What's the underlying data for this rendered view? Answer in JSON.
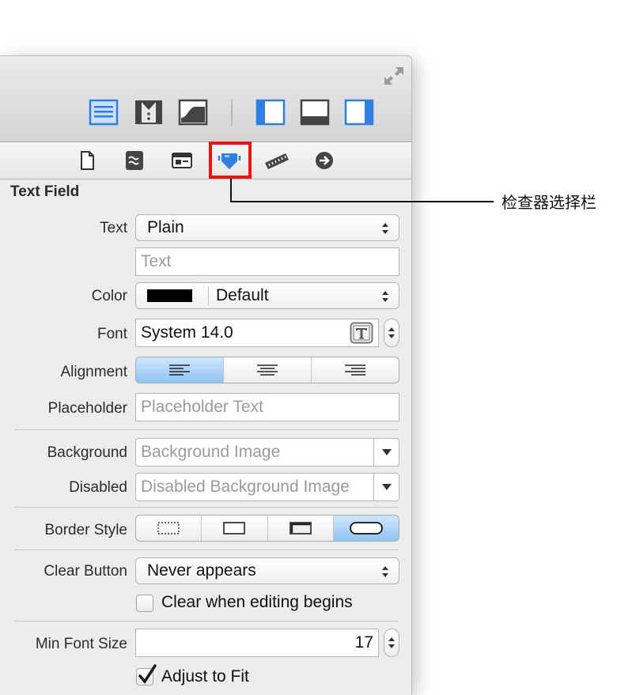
{
  "inspector_title": "Text Field",
  "callout": {
    "text": "检查器选择栏"
  },
  "text_row": {
    "label": "Text",
    "value": "Plain"
  },
  "text_field": {
    "placeholder": "Text"
  },
  "color_row": {
    "label": "Color",
    "value": "Default",
    "swatch": "#000000"
  },
  "font_row": {
    "label": "Font",
    "value": "System 14.0"
  },
  "alignment_row": {
    "label": "Alignment",
    "options": [
      "left",
      "center",
      "right"
    ],
    "selected": "left"
  },
  "placeholder_row": {
    "label": "Placeholder",
    "placeholder": "Placeholder Text"
  },
  "background_row": {
    "label": "Background",
    "placeholder": "Background Image"
  },
  "disabled_row": {
    "label": "Disabled",
    "placeholder": "Disabled Background Image"
  },
  "border_row": {
    "label": "Border Style",
    "options": [
      "none",
      "line",
      "bezel",
      "rounded"
    ],
    "selected": "rounded"
  },
  "clear_button_row": {
    "label": "Clear Button",
    "value": "Never appears"
  },
  "clear_checkbox": {
    "label": "Clear when editing begins",
    "checked": false
  },
  "min_font_row": {
    "label": "Min Font Size",
    "value": "17"
  },
  "adjust_checkbox": {
    "label": "Adjust to Fit",
    "checked": true
  },
  "colors": {
    "accent_blue": "#2f7fe0",
    "highlight_red": "#ee1111",
    "panel_bg": "#ececec"
  }
}
